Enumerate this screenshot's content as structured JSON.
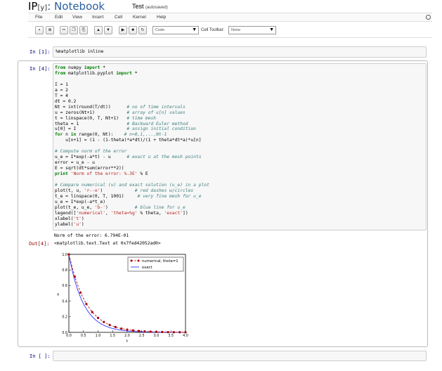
{
  "header": {
    "logo_ip": "IP",
    "logo_y": "[y]",
    "logo_rest": ": Notebook",
    "notebook_name": "Test",
    "save_status": "(autosaved)"
  },
  "menu": [
    "File",
    "Edit",
    "View",
    "Insert",
    "Cell",
    "Kernel",
    "Help"
  ],
  "toolbar": {
    "cell_type": "Code",
    "cell_toolbar_label": "Cell Toolbar:",
    "cell_toolbar_value": "None"
  },
  "cells": {
    "cell1_prompt": "In [1]:",
    "cell1_code": "%matplotlib inline",
    "cell2_prompt": "In [4]:",
    "stdout": "Norm of the error: 6.794E-01",
    "out_prompt": "Out[4]:",
    "out_value": "<matplotlib.text.Text at 0x7fed42052ad0>",
    "empty_prompt": "In [ ]:"
  },
  "chart_data": {
    "type": "line",
    "xlabel": "t",
    "ylabel": "u",
    "xlim": [
      0,
      4
    ],
    "ylim": [
      0,
      1
    ],
    "xticks": [
      "0.0",
      "0.5",
      "1.0",
      "1.5",
      "2.0",
      "2.5",
      "3.0",
      "3.5",
      "4.0"
    ],
    "yticks": [
      "0.0",
      "0.2",
      "0.4",
      "0.6",
      "0.8",
      "1.0"
    ],
    "legend_placement": "top-right",
    "series": [
      {
        "name": "numerical, theta=1",
        "style": "red dashes with circles",
        "color": "#aa0000",
        "x": [
          0,
          0.2,
          0.4,
          0.6,
          0.8,
          1.0,
          1.2,
          1.4,
          1.6,
          1.8,
          2.0,
          2.2,
          2.4,
          2.6,
          2.8,
          3.0,
          3.2,
          3.4,
          3.6,
          3.8,
          4.0
        ],
        "y": [
          1.0,
          0.714,
          0.51,
          0.364,
          0.26,
          0.186,
          0.133,
          0.095,
          0.068,
          0.048,
          0.035,
          0.025,
          0.018,
          0.013,
          0.009,
          0.006,
          0.005,
          0.003,
          0.002,
          0.002,
          0.001
        ]
      },
      {
        "name": "exact",
        "style": "blue line",
        "color": "#3333ff"
      }
    ]
  }
}
